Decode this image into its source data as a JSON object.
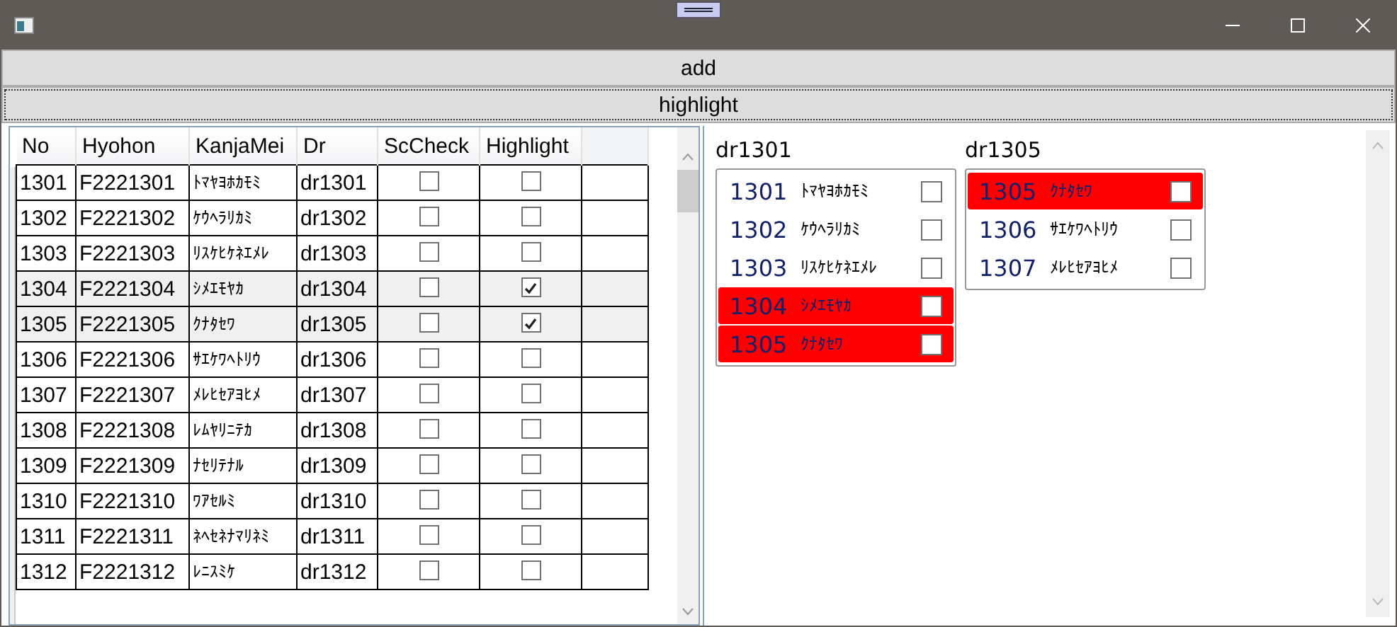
{
  "buttons": [
    {
      "label": "add",
      "focused": false
    },
    {
      "label": "highlight",
      "focused": true
    }
  ],
  "table": {
    "columns": [
      "No",
      "Hyohon",
      "KanjaMei",
      "Dr",
      "ScCheck",
      "Highlight"
    ],
    "rows": [
      {
        "no": "1301",
        "hyohon": "F2221301",
        "kanja": "ﾄﾏﾔﾖﾎｶﾓﾐ",
        "dr": "dr1301",
        "sc_check": false,
        "highlight": false,
        "selected": false
      },
      {
        "no": "1302",
        "hyohon": "F2221302",
        "kanja": "ｹｳﾍﾗﾘｶﾐ",
        "dr": "dr1302",
        "sc_check": false,
        "highlight": false,
        "selected": false
      },
      {
        "no": "1303",
        "hyohon": "F2221303",
        "kanja": "ﾘｽｹﾋｹﾈｴﾒﾚ",
        "dr": "dr1303",
        "sc_check": false,
        "highlight": false,
        "selected": false
      },
      {
        "no": "1304",
        "hyohon": "F2221304",
        "kanja": "ｼﾒｴﾓﾔｶ",
        "dr": "dr1304",
        "sc_check": false,
        "highlight": true,
        "selected": true
      },
      {
        "no": "1305",
        "hyohon": "F2221305",
        "kanja": "ｸﾅﾀｾﾜ",
        "dr": "dr1305",
        "sc_check": false,
        "highlight": true,
        "selected": true
      },
      {
        "no": "1306",
        "hyohon": "F2221306",
        "kanja": "ｻｴｹﾜﾍﾄﾘｳ",
        "dr": "dr1306",
        "sc_check": false,
        "highlight": false,
        "selected": false
      },
      {
        "no": "1307",
        "hyohon": "F2221307",
        "kanja": "ﾒﾚﾋｾｱﾖﾋﾒ",
        "dr": "dr1307",
        "sc_check": false,
        "highlight": false,
        "selected": false
      },
      {
        "no": "1308",
        "hyohon": "F2221308",
        "kanja": "ﾚﾑﾔﾘﾆﾃｶ",
        "dr": "dr1308",
        "sc_check": false,
        "highlight": false,
        "selected": false
      },
      {
        "no": "1309",
        "hyohon": "F2221309",
        "kanja": "ﾅｾﾘﾃﾅﾙ",
        "dr": "dr1309",
        "sc_check": false,
        "highlight": false,
        "selected": false
      },
      {
        "no": "1310",
        "hyohon": "F2221310",
        "kanja": "ﾜｱｾﾙﾐ",
        "dr": "dr1310",
        "sc_check": false,
        "highlight": false,
        "selected": false
      },
      {
        "no": "1311",
        "hyohon": "F2221311",
        "kanja": "ﾈﾍｾﾈﾅﾏﾘﾈﾐ",
        "dr": "dr1311",
        "sc_check": false,
        "highlight": false,
        "selected": false
      },
      {
        "no": "1312",
        "hyohon": "F2221312",
        "kanja": "ﾚﾆｽﾐｹ",
        "dr": "dr1312",
        "sc_check": false,
        "highlight": false,
        "selected": false
      }
    ]
  },
  "groups": [
    {
      "title": "dr1301",
      "items": [
        {
          "no": "1301",
          "kanja": "ﾄﾏﾔﾖﾎｶﾓﾐ",
          "highlight": false,
          "checked": false
        },
        {
          "no": "1302",
          "kanja": "ｹｳﾍﾗﾘｶﾐ",
          "highlight": false,
          "checked": false
        },
        {
          "no": "1303",
          "kanja": "ﾘｽｹﾋｹﾈｴﾒﾚ",
          "highlight": false,
          "checked": false
        },
        {
          "no": "1304",
          "kanja": "ｼﾒｴﾓﾔｶ",
          "highlight": true,
          "checked": false
        },
        {
          "no": "1305",
          "kanja": "ｸﾅﾀｾﾜ",
          "highlight": true,
          "checked": false
        }
      ]
    },
    {
      "title": "dr1305",
      "items": [
        {
          "no": "1305",
          "kanja": "ｸﾅﾀｾﾜ",
          "highlight": true,
          "checked": false
        },
        {
          "no": "1306",
          "kanja": "ｻｴｹﾜﾍﾄﾘｳ",
          "highlight": false,
          "checked": false
        },
        {
          "no": "1307",
          "kanja": "ﾒﾚﾋｾｱﾖﾋﾒ",
          "highlight": false,
          "checked": false
        }
      ]
    }
  ]
}
